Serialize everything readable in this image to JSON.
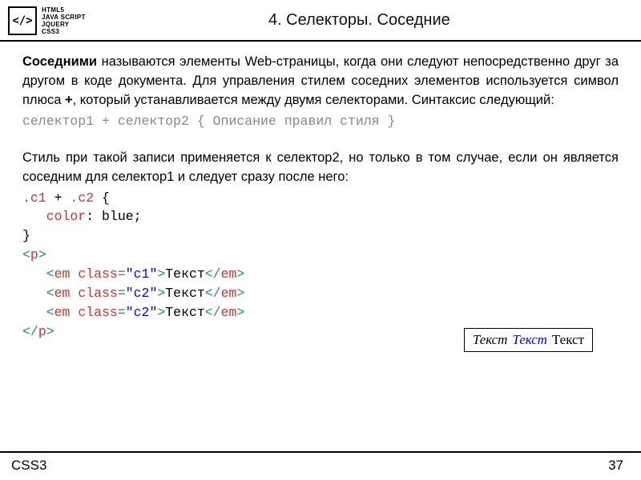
{
  "header": {
    "logo_glyph": "</>",
    "logo_lines": [
      "HTML5",
      "JAVA SCRIPT",
      "JQUERY",
      "CSS3"
    ],
    "title": "4. Селекторы. Соседние"
  },
  "body": {
    "p1_bold": "Соседними",
    "p1_rest": " называются элементы Web-страницы, когда они следуют непосредственно друг за другом в коде документа. Для управления стилем соседних элементов используется символ плюса ",
    "p1_plus": "+",
    "p1_tail": ", который устанавливается между двумя селекторами. Синтаксис следующий:",
    "syntax_line": "селектор1 + селектор2 { Описание правил стиля }",
    "p2": "Стиль при такой записи применяется к селектор2, но только в том случае, если он является соседним для селектор1 и следует сразу после него:",
    "code": {
      "l1_a": ".c1",
      "l1_b": " + ",
      "l1_c": ".c2",
      "l1_d": " {",
      "l2_a": "   color",
      "l2_b": ": blue;",
      "l3": "}",
      "l4_a": "<",
      "l4_b": "p",
      "l4_c": ">",
      "l5_a": "   <",
      "l5_b": "em",
      "l5_c": " class",
      "l5_d": "=",
      "l5_e": "\"c1\"",
      "l5_f": ">",
      "l5_g": "Текст",
      "l5_h": "</",
      "l5_i": "em",
      "l5_j": ">",
      "l6_e": "\"c2\"",
      "l8_a": "</",
      "l8_b": "p",
      "l8_c": ">"
    },
    "output": {
      "t1": "Текст",
      "t2": "Текст",
      "t3": "Текст"
    }
  },
  "footer": {
    "left": "CSS3",
    "page": "37"
  }
}
